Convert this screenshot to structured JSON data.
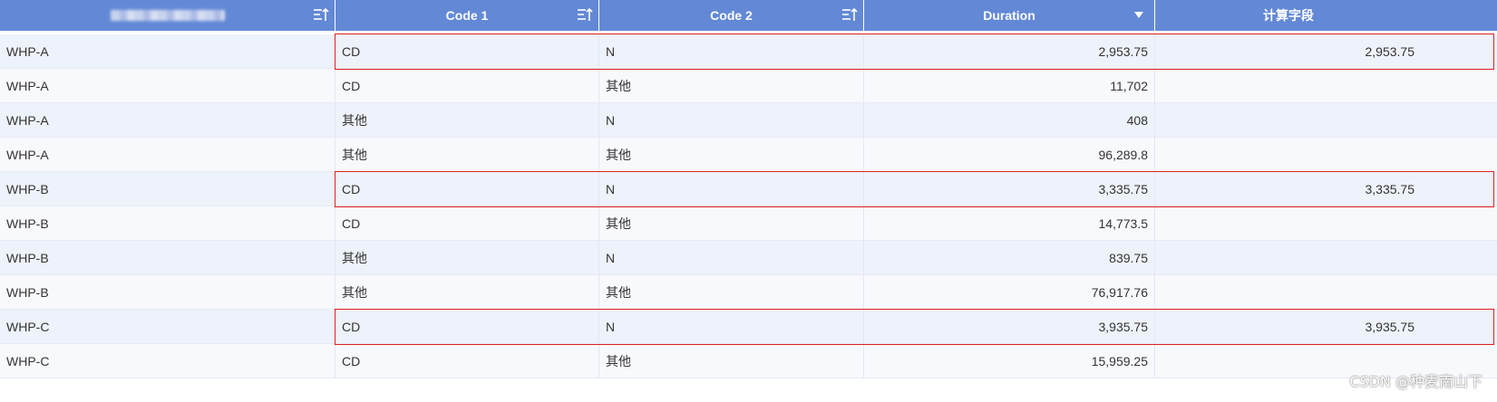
{
  "table": {
    "columns": [
      {
        "label": "",
        "obscured": true,
        "icon": "sort-icon"
      },
      {
        "label": "Code 1",
        "icon": "sort-icon"
      },
      {
        "label": "Code 2",
        "icon": "sort-icon"
      },
      {
        "label": "Duration",
        "icon": "sort-descending-icon"
      },
      {
        "label": "计算字段",
        "icon": null
      }
    ],
    "rows": [
      {
        "name": "WHP-A",
        "code1": "CD",
        "code2": "N",
        "duration": "2,953.75",
        "calc": "2,953.75",
        "highlighted": true
      },
      {
        "name": "WHP-A",
        "code1": "CD",
        "code2": "其他",
        "duration": "11,702",
        "calc": "",
        "highlighted": false
      },
      {
        "name": "WHP-A",
        "code1": "其他",
        "code2": "N",
        "duration": "408",
        "calc": "",
        "highlighted": false
      },
      {
        "name": "WHP-A",
        "code1": "其他",
        "code2": "其他",
        "duration": "96,289.8",
        "calc": "",
        "highlighted": false
      },
      {
        "name": "WHP-B",
        "code1": "CD",
        "code2": "N",
        "duration": "3,335.75",
        "calc": "3,335.75",
        "highlighted": true
      },
      {
        "name": "WHP-B",
        "code1": "CD",
        "code2": "其他",
        "duration": "14,773.5",
        "calc": "",
        "highlighted": false
      },
      {
        "name": "WHP-B",
        "code1": "其他",
        "code2": "N",
        "duration": "839.75",
        "calc": "",
        "highlighted": false
      },
      {
        "name": "WHP-B",
        "code1": "其他",
        "code2": "其他",
        "duration": "76,917.76",
        "calc": "",
        "highlighted": false
      },
      {
        "name": "WHP-C",
        "code1": "CD",
        "code2": "N",
        "duration": "3,935.75",
        "calc": "3,935.75",
        "highlighted": true
      },
      {
        "name": "WHP-C",
        "code1": "CD",
        "code2": "其他",
        "duration": "15,959.25",
        "calc": "",
        "highlighted": false
      }
    ]
  },
  "colors": {
    "header_bg": "#6389d6",
    "highlight_border": "#e02020",
    "row_odd": "#eef2fa",
    "row_even": "#f8f9fd"
  },
  "watermark": "CSDN @种麦南山下"
}
